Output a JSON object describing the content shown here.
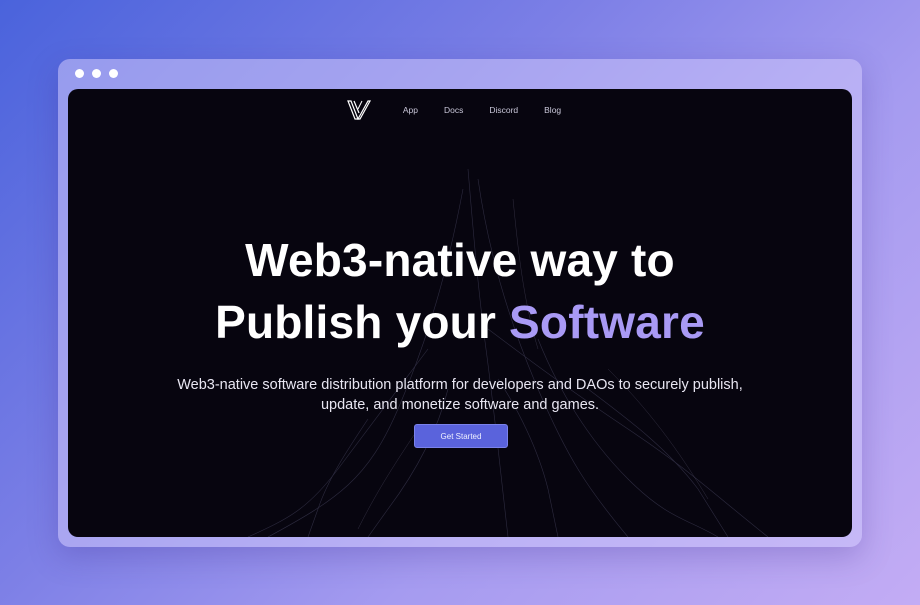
{
  "nav": {
    "items": [
      {
        "label": "App"
      },
      {
        "label": "Docs"
      },
      {
        "label": "Discord"
      },
      {
        "label": "Blog"
      }
    ]
  },
  "hero": {
    "line1": "Web3-native way to",
    "line2_prefix": "Publish your",
    "line2_accent": "Software",
    "subtitle": "Web3-native software distribution platform for developers and DAOs to securely publish, update, and monetize software and games.",
    "cta_label": "Get Started"
  },
  "colors": {
    "accent": "#a99af5",
    "button": "#5a63dc",
    "screen_bg": "#07050f"
  }
}
